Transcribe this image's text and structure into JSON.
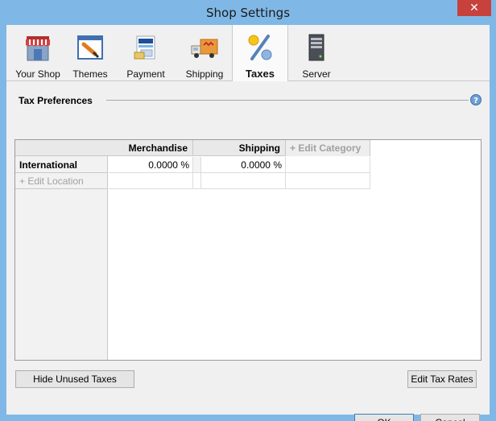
{
  "window": {
    "title": "Shop Settings",
    "close_glyph": "✕"
  },
  "toolbar": {
    "items": [
      {
        "label": "Your Shop",
        "icon": "storefront-icon"
      },
      {
        "label": "Themes",
        "icon": "theme-brush-icon"
      },
      {
        "label": "Payment",
        "icon": "payment-card-icon"
      },
      {
        "label": "Shipping",
        "icon": "delivery-truck-icon"
      },
      {
        "label": "Taxes",
        "icon": "percent-icon",
        "active": true
      },
      {
        "label": "Server",
        "icon": "server-tower-icon"
      }
    ]
  },
  "tax_preferences": {
    "title": "Tax Preferences",
    "help_icon": "help-icon",
    "columns": [
      "Merchandise",
      "Shipping"
    ],
    "edit_category": "+ Edit Category",
    "rows": [
      {
        "location": "International",
        "values": [
          "0.0000 %",
          "0.0000 %"
        ]
      }
    ],
    "edit_location": "+ Edit Location"
  },
  "buttons": {
    "hide_unused": "Hide Unused Taxes",
    "edit_rates": "Edit Tax Rates",
    "ok": "OK",
    "cancel": "Cancel"
  },
  "colors": {
    "title_bar": "#7fb8e6",
    "close": "#c7423d",
    "accent": "#3c7fb1"
  }
}
